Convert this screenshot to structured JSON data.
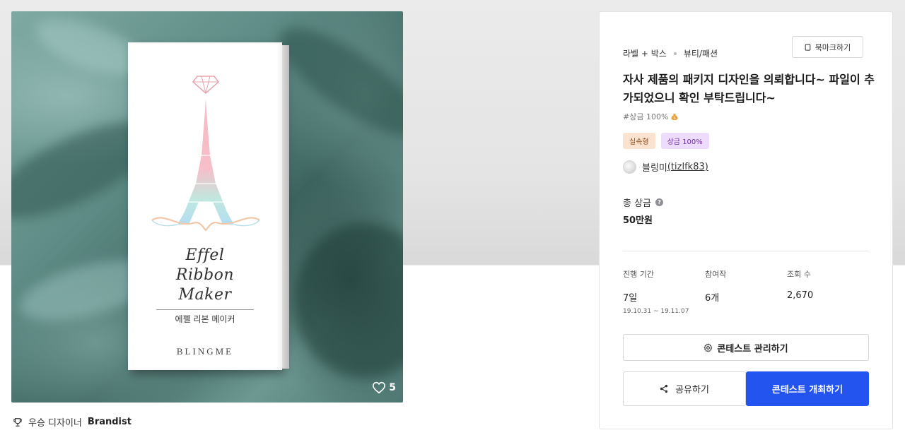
{
  "hero": {
    "product": {
      "title_lines": [
        "Effel",
        "Ribbon",
        "Maker"
      ],
      "subtitle": "에펠 리본 메이커",
      "brand": "BLINGME"
    },
    "likes_count": "5"
  },
  "award": {
    "prefix": "우승 디자이너",
    "designer": "Brandist"
  },
  "card": {
    "category_main": "라벨 + 박스",
    "category_sub": "뷰티/패션",
    "bookmark_label": "북마크하기",
    "title": "자사 제품의 패키지 디자인을 의뢰합니다~ 파일이 추가되었으니 확인 부탁드립니다~",
    "hashtag": "#상금 100%",
    "badges": [
      "실속형",
      "상금 100%"
    ],
    "host": {
      "name": "블링미",
      "handle": "(tizlfk83)"
    },
    "prize": {
      "label": "총 상금",
      "value": "50만원"
    },
    "stats": {
      "period_label": "진행 기간",
      "period_value": "7일",
      "period_dates": "19.10.31 ~ 19.11.07",
      "entries_label": "참여작",
      "entries_value": "6개",
      "views_label": "조회 수",
      "views_value": "2,670"
    },
    "manage_label": "콘테스트 관리하기",
    "share_label": "공유하기",
    "open_label": "콘테스트 개최하기"
  },
  "colors": {
    "primary": "#2354f0",
    "badge_orange_bg": "#fbe3cf",
    "badge_purple_bg": "#eddcfb"
  },
  "icons": [
    "heart-icon",
    "trophy-icon",
    "bookmark-icon",
    "question-icon",
    "gear-icon",
    "share-icon",
    "money-bag-icon"
  ]
}
